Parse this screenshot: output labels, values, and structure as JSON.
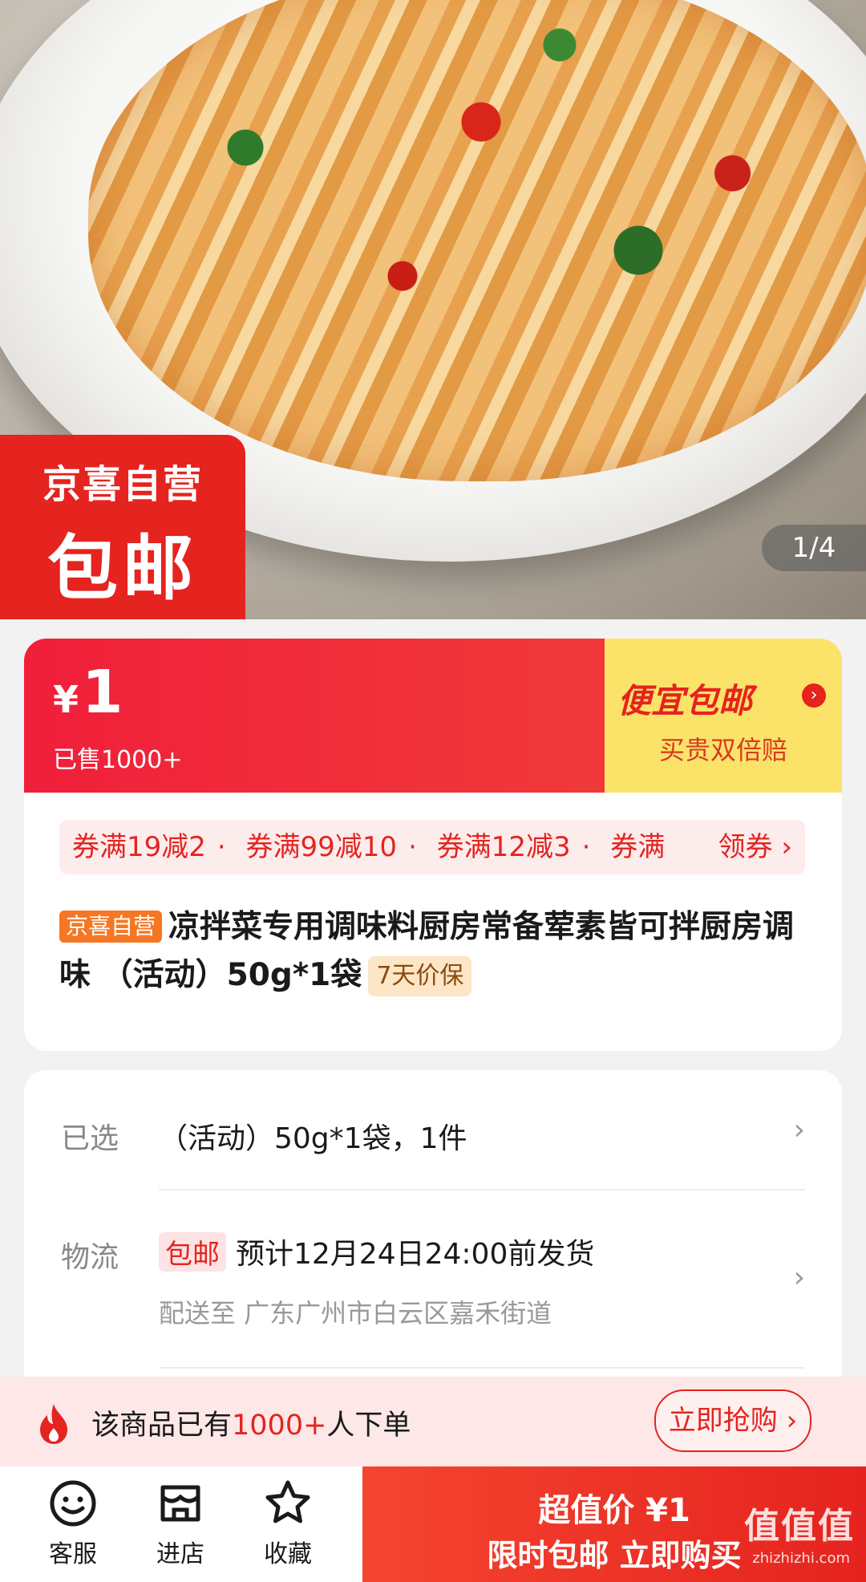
{
  "hero": {
    "badge_line1": "京喜自营",
    "badge_line2": "包邮",
    "counter": "1/4"
  },
  "price": {
    "currency": "¥",
    "amount": "1",
    "sold": "已售1000+",
    "promo_title": "便宜包邮",
    "promo_sub": "买贵双倍赔"
  },
  "coupons": {
    "items": [
      "券满19减2",
      "券满99减10",
      "券满12减3",
      "券满"
    ],
    "get_label": "领券 ›"
  },
  "product": {
    "tag": "京喜自营",
    "title": "凉拌菜专用调味料厨房常备荤素皆可拌厨房调味 （活动）50g*1袋",
    "price_protect": "7天价保"
  },
  "selection": {
    "selected_label": "已选",
    "selected_value": "（活动）50g*1袋，1件",
    "logistics_label": "物流",
    "free_tag": "包邮",
    "ship_text": "预计12月24日24:00前发货",
    "address": "配送至  广东广州市白云区嘉禾街道"
  },
  "notice": {
    "prefix": "该商品已有",
    "highlight": "1000+",
    "suffix": "人下单",
    "button": "立即抢购 ›"
  },
  "bottom": {
    "service": "客服",
    "store": "进店",
    "favorite": "收藏",
    "cta_line1": "超值价 ¥1",
    "cta_line2": "限时包邮 立即购买"
  },
  "watermark": {
    "brand": "值值值",
    "url": "zhizhizhi.com"
  },
  "colors": {
    "accent_red": "#e5231f",
    "promo_yellow": "#fbe36a"
  }
}
